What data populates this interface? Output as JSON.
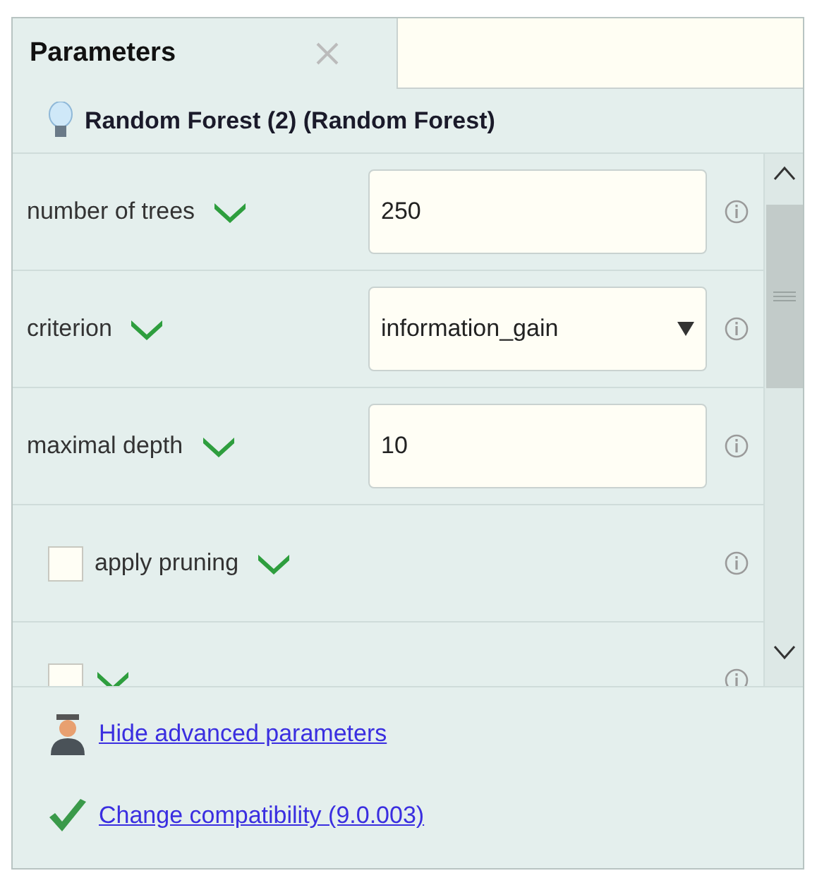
{
  "tab": {
    "label": "Parameters",
    "selected": true
  },
  "operator": {
    "title": "Random Forest (2) (Random Forest)"
  },
  "parameters": [
    {
      "kind": "text",
      "label": "number of trees",
      "value": "250"
    },
    {
      "kind": "select",
      "label": "criterion",
      "value": "information_gain"
    },
    {
      "kind": "text",
      "label": "maximal depth",
      "value": "10"
    },
    {
      "kind": "checkbox",
      "label": "apply pruning",
      "checked": false
    },
    {
      "kind": "checkbox",
      "checked": false
    }
  ],
  "links": [
    {
      "kind": "expert",
      "label": "Hide advanced parameters"
    },
    {
      "kind": "check",
      "label": "Change compatibility (9.0.003)"
    }
  ]
}
